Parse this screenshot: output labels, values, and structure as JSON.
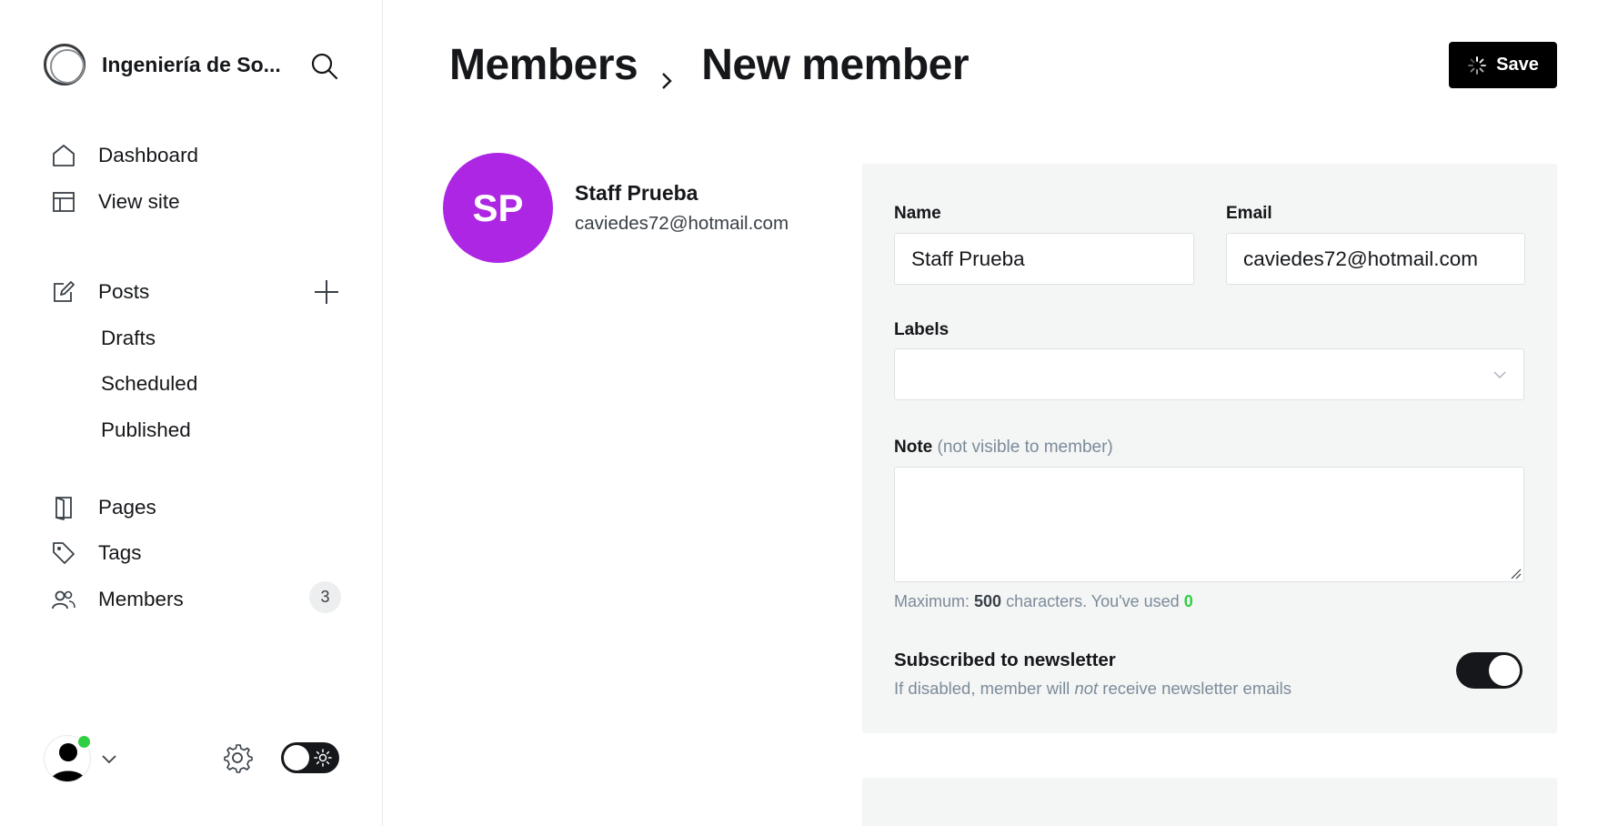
{
  "sidebar": {
    "site_title": "Ingeniería de So...",
    "nav": {
      "dashboard": "Dashboard",
      "view_site": "View site",
      "posts": "Posts",
      "drafts": "Drafts",
      "scheduled": "Scheduled",
      "published": "Published",
      "pages": "Pages",
      "tags": "Tags",
      "members": "Members",
      "members_count": "3"
    },
    "icons": [
      "search-icon",
      "home-icon",
      "layout-icon",
      "edit-icon",
      "plus-icon",
      "book-icon",
      "tag-icon",
      "users-icon",
      "gear-icon",
      "sun-icon",
      "chevron-down-icon"
    ]
  },
  "header": {
    "crumb_parent": "Members",
    "crumb_current": "New member",
    "save_label": "Save"
  },
  "member": {
    "initials": "SP",
    "name": "Staff Prueba",
    "email": "caviedes72@hotmail.com",
    "avatar_color": "#ad26e4"
  },
  "form": {
    "name_label": "Name",
    "name_value": "Staff Prueba",
    "email_label": "Email",
    "email_value": "caviedes72@hotmail.com",
    "labels_label": "Labels",
    "note_label": "Note",
    "note_hint": "(not visible to member)",
    "note_value": "",
    "counter_prefix": "Maximum:",
    "counter_max": "500",
    "counter_mid": "characters. You've used",
    "counter_used": "0",
    "newsletter_title": "Subscribed to newsletter",
    "newsletter_desc_pre": "If disabled, member will",
    "newsletter_desc_em": "not",
    "newsletter_desc_post": "receive newsletter emails",
    "newsletter_enabled": true
  },
  "colors": {
    "accent_online": "#30cf43",
    "primary_dark": "#15171a",
    "panel_bg": "#f4f5f5"
  }
}
